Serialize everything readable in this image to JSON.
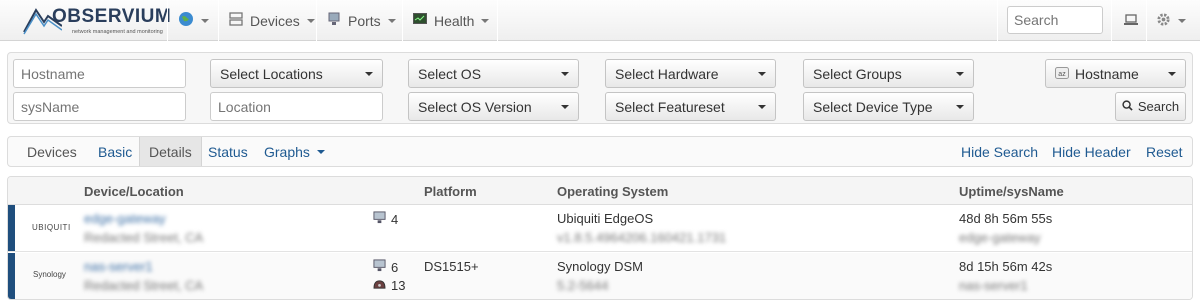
{
  "brand": {
    "name": "OBSERVIUM",
    "tagline": "network management and monitoring"
  },
  "nav": {
    "items": [
      {
        "label": "Devices",
        "icon": "server-icon"
      },
      {
        "label": "Ports",
        "icon": "network-port-icon"
      },
      {
        "label": "Health",
        "icon": "monitor-icon"
      }
    ],
    "search_placeholder": "Search"
  },
  "search_form": {
    "hostname_placeholder": "Hostname",
    "sysname_placeholder": "sysName",
    "location_placeholder": "Location",
    "selects": {
      "locations": "Select Locations",
      "os": "Select OS",
      "hardware": "Select Hardware",
      "groups": "Select Groups",
      "os_version": "Select OS Version",
      "featureset": "Select Featureset",
      "device_type": "Select Device Type"
    },
    "sort_select": "Hostname",
    "search_button": "Search"
  },
  "tabs": {
    "title": "Devices",
    "items": [
      "Basic",
      "Details",
      "Status",
      "Graphs"
    ],
    "active": "Details",
    "actions": [
      "Hide Search",
      "Hide Header",
      "Reset"
    ]
  },
  "table": {
    "headers": [
      "Device/Location",
      "Platform",
      "Operating System",
      "Uptime/sysName"
    ],
    "rows": [
      {
        "vendor": "UBIQUITI",
        "hostname": "edge-gateway",
        "location": "Redacted Street, CA",
        "ports": "4",
        "disks": "",
        "platform": "",
        "os": "Ubiquiti EdgeOS",
        "os_version": "v1.8.5.4964206.160421.1731",
        "uptime": "48d 8h 56m 55s",
        "sysname": "edge-gateway",
        "stripe_color": "#1f4e7d"
      },
      {
        "vendor": "Synology",
        "hostname": "nas-server1",
        "location": "Redacted Street, CA",
        "ports": "6",
        "disks": "13",
        "platform": "DS1515+",
        "os": "Synology DSM",
        "os_version": "5.2-5644",
        "uptime": "8d 15h 56m 42s",
        "sysname": "nas-server1",
        "stripe_color": "#1f4e7d"
      }
    ]
  }
}
